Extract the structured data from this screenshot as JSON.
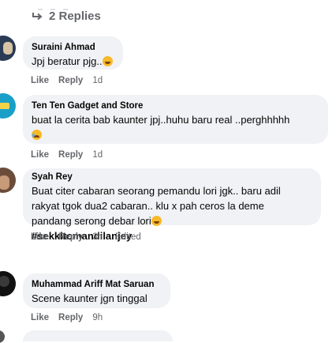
{
  "replies_label": "2 Replies",
  "comments": [
    {
      "name": "Suraini Ahmad",
      "lines": [
        "Jpj beratur pjg.."
      ],
      "emoji": "grin",
      "like": "Like",
      "reply": "Reply",
      "time": "1d"
    },
    {
      "name": "Ten Ten Gadget and Store",
      "lines": [
        "buat la cerita bab kaunter jpj..huhu baru real ..perghhhhh"
      ],
      "emoji": "cry",
      "like": "Like",
      "reply": "Reply",
      "time": "1d"
    },
    {
      "name": "Syah Rey",
      "lines": [
        "Buat citer cabaran seorang pemandu lori jgk.. baru adil",
        "rakyat tgok dua2 cabaran.. klu x pah ceros la deme",
        "pandang serong debar lori"
      ],
      "hashtag": "#sekkitomandilanjey",
      "emoji": "grin",
      "like": "Like",
      "reply": "Reply",
      "time": "3h",
      "edited": "Edited"
    },
    {
      "name": "Muhammad Ariff Mat Saruan",
      "lines": [
        "Scene kaunter jgn tinggal"
      ],
      "like": "Like",
      "reply": "Reply",
      "time": "9h"
    }
  ]
}
